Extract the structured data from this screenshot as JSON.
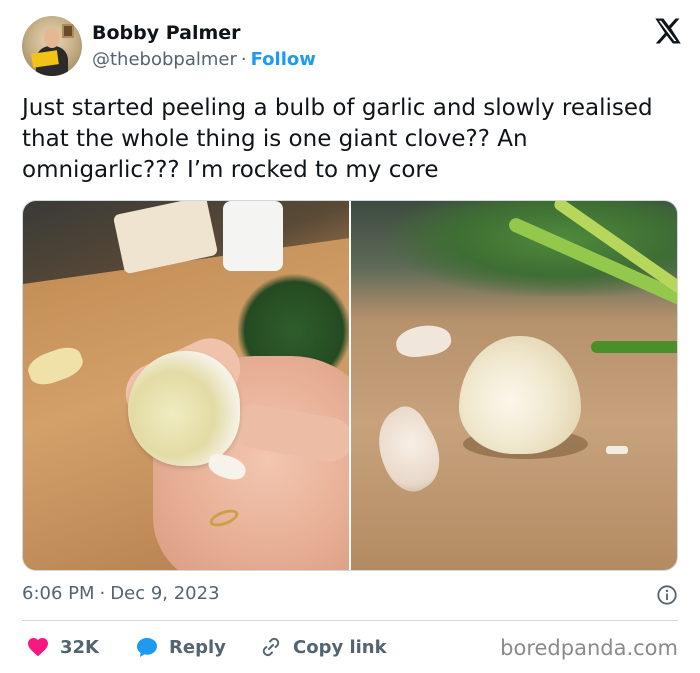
{
  "author": {
    "name": "Bobby Palmer",
    "handle": "@thebobpalmer",
    "separator": "·",
    "follow_label": "Follow"
  },
  "platform_icon": "x-logo-icon",
  "tweet": {
    "text": "Just started peeling a bulb of garlic and slowly realised that the whole thing is one giant clove?? An omnigarlic??? I’m rocked to my core"
  },
  "meta": {
    "time": "6:06 PM",
    "separator": "·",
    "date": "Dec 9, 2023",
    "info_icon": "info-icon"
  },
  "actions": {
    "like_count": "32K",
    "reply_label": "Reply",
    "copy_link_label": "Copy link"
  },
  "watermark": "boredpanda.com",
  "colors": {
    "like_red": "#f91880",
    "reply_blue": "#1d9bf0",
    "follow_blue": "#1d9bf0",
    "muted_text": "#536471",
    "text": "#0f1419",
    "border": "#cfd9de"
  }
}
